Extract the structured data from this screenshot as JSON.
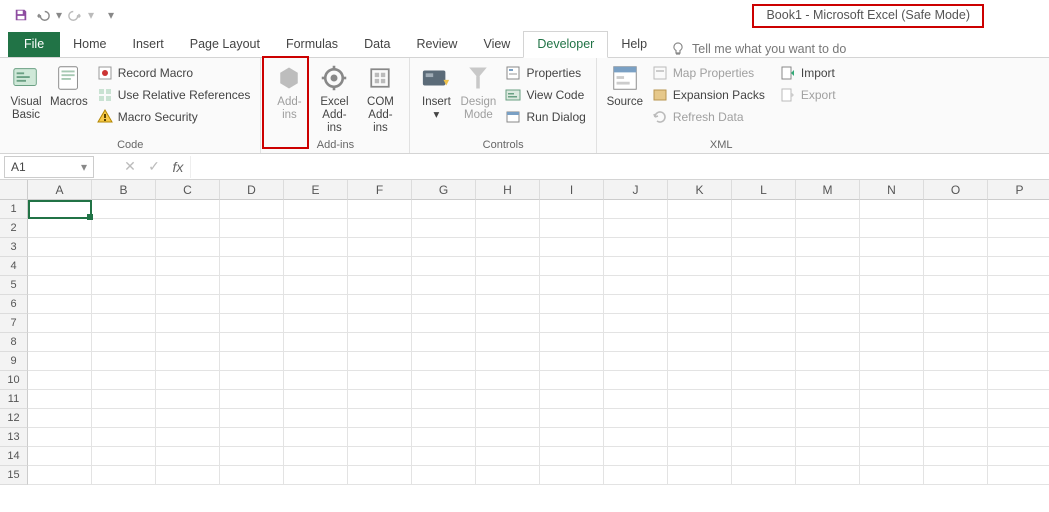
{
  "title": "Book1  -  Microsoft Excel (Safe Mode)",
  "tabs": {
    "file": "File",
    "items": [
      "Home",
      "Insert",
      "Page Layout",
      "Formulas",
      "Data",
      "Review",
      "View",
      "Developer",
      "Help"
    ],
    "active": "Developer",
    "tellme": "Tell me what you want to do"
  },
  "ribbon": {
    "code": {
      "label": "Code",
      "visual_basic": "Visual\nBasic",
      "macros": "Macros",
      "record_macro": "Record Macro",
      "use_relative": "Use Relative References",
      "macro_security": "Macro Security"
    },
    "addins": {
      "label": "Add-ins",
      "addins": "Add-\nins",
      "excel_addins": "Excel\nAdd-ins",
      "com_addins": "COM\nAdd-ins"
    },
    "controls": {
      "label": "Controls",
      "insert": "Insert",
      "design_mode": "Design\nMode",
      "properties": "Properties",
      "view_code": "View Code",
      "run_dialog": "Run Dialog"
    },
    "xml": {
      "label": "XML",
      "source": "Source",
      "map_properties": "Map Properties",
      "expansion_packs": "Expansion Packs",
      "refresh_data": "Refresh Data",
      "import": "Import",
      "export": "Export"
    }
  },
  "namebox": "A1",
  "columns": [
    "A",
    "B",
    "C",
    "D",
    "E",
    "F",
    "G",
    "H",
    "I",
    "J",
    "K",
    "L",
    "M",
    "N",
    "O",
    "P"
  ],
  "rows": [
    1,
    2,
    3,
    4,
    5,
    6,
    7,
    8,
    9,
    10,
    11,
    12,
    13,
    14,
    15
  ]
}
